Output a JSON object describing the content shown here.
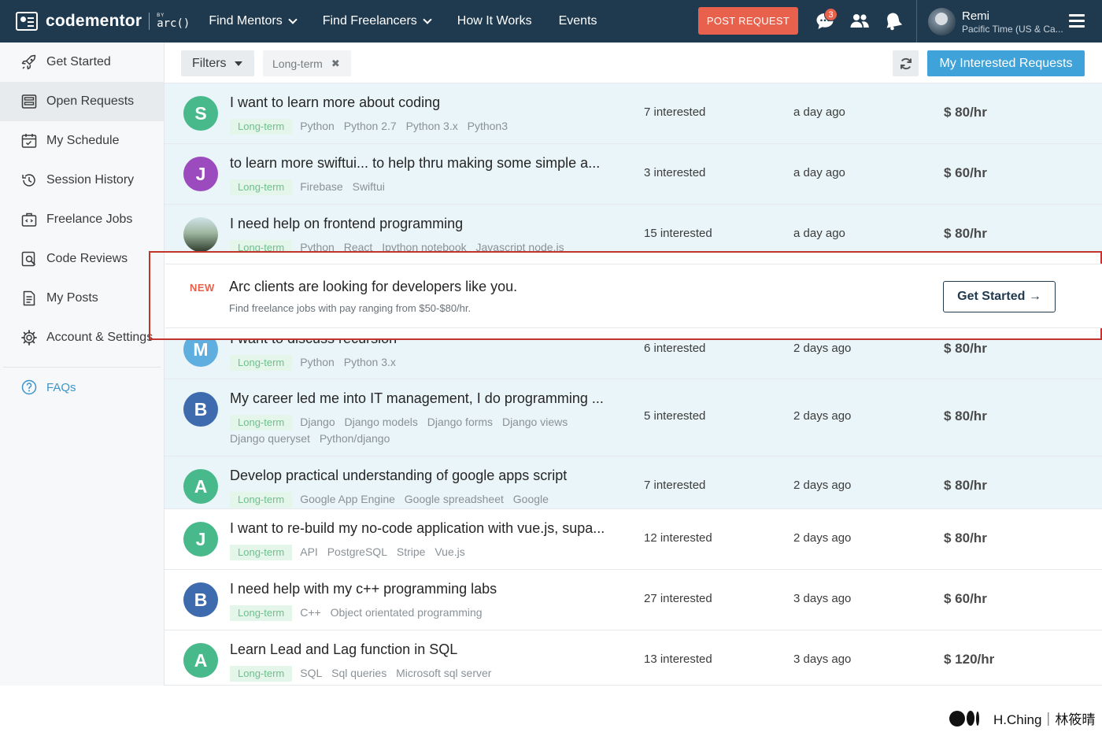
{
  "brand": {
    "name": "codementor",
    "by": "BY",
    "arc": "arc()"
  },
  "nav": {
    "items": [
      {
        "label": "Find Mentors",
        "dropdown": true
      },
      {
        "label": "Find Freelancers",
        "dropdown": true
      },
      {
        "label": "How It Works",
        "dropdown": false
      },
      {
        "label": "Events",
        "dropdown": false
      }
    ],
    "post_request": "POST REQUEST",
    "messages_badge": "3",
    "icons": [
      "chat-icon",
      "people-icon",
      "bell-icon",
      "menu-icon"
    ]
  },
  "user": {
    "name": "Remi",
    "timezone": "Pacific Time (US & Ca..."
  },
  "sidebar": {
    "items": [
      {
        "label": "Get Started",
        "icon": "rocket-icon"
      },
      {
        "label": "Open Requests",
        "icon": "list-icon",
        "active": true
      },
      {
        "label": "My Schedule",
        "icon": "calendar-icon"
      },
      {
        "label": "Session History",
        "icon": "history-icon"
      },
      {
        "label": "Freelance Jobs",
        "icon": "briefcase-icon"
      },
      {
        "label": "Code Reviews",
        "icon": "code-review-icon"
      },
      {
        "label": "My Posts",
        "icon": "document-icon"
      },
      {
        "label": "Account & Settings",
        "icon": "gear-icon"
      }
    ],
    "faq": "FAQs"
  },
  "filterbar": {
    "filters_label": "Filters",
    "active_chip": "Long-term",
    "interested_button": "My Interested Requests"
  },
  "requests": [
    {
      "initial": "S",
      "color": "#48b98a",
      "title": "I want to learn more about coding",
      "tags": [
        "Python",
        "Python 2.7",
        "Python 3.x",
        "Python3"
      ],
      "interested": "7 interested",
      "ago": "a day ago",
      "rate": "$ 80/hr"
    },
    {
      "initial": "J",
      "color": "#9b4bbd",
      "title": "to learn more swiftui... to help thru making some simple a...",
      "tags": [
        "Firebase",
        "Swiftui"
      ],
      "interested": "3 interested",
      "ago": "a day ago",
      "rate": "$ 60/hr"
    },
    {
      "initial": "",
      "color": "#3e5a3e",
      "photo": true,
      "title": "I need help on frontend programming",
      "tags": [
        "Python",
        "React",
        "Ipython notebook",
        "Javascript node.js"
      ],
      "interested": "15 interested",
      "ago": "a day ago",
      "rate": "$ 80/hr"
    },
    {
      "initial": "M",
      "color": "#5faee0",
      "title": "I want to discuss recursion",
      "tags": [
        "Python",
        "Python 3.x"
      ],
      "interested": "6 interested",
      "ago": "2 days ago",
      "rate": "$ 80/hr"
    },
    {
      "initial": "B",
      "color": "#3d6bad",
      "title": "My career led me into IT management, I do programming ...",
      "tags": [
        "Django",
        "Django models",
        "Django forms",
        "Django views",
        "Django queryset",
        "Python/django"
      ],
      "interested": "5 interested",
      "ago": "2 days ago",
      "rate": "$ 80/hr"
    },
    {
      "initial": "A",
      "color": "#48b98a",
      "title": "Develop practical understanding of google apps script",
      "tags": [
        "Google App Engine",
        "Google spreadsheet",
        "Google"
      ],
      "interested": "7 interested",
      "ago": "2 days ago",
      "rate": "$ 80/hr"
    },
    {
      "initial": "J",
      "color": "#48b98a",
      "title": "I want to re-build my no-code application with vue.js, supa...",
      "tags": [
        "API",
        "PostgreSQL",
        "Stripe",
        "Vue.js"
      ],
      "interested": "12 interested",
      "ago": "2 days ago",
      "rate": "$ 80/hr"
    },
    {
      "initial": "B",
      "color": "#3d6bad",
      "title": "I need help with my c++ programming labs",
      "tags": [
        "C++",
        "Object orientated programming"
      ],
      "interested": "27 interested",
      "ago": "3 days ago",
      "rate": "$ 60/hr"
    },
    {
      "initial": "A",
      "color": "#48b98a",
      "title": "Learn Lead and Lag function in SQL",
      "tags": [
        "SQL",
        "Sql queries",
        "Microsoft sql server"
      ],
      "interested": "13 interested",
      "ago": "3 days ago",
      "rate": "$ 120/hr"
    }
  ],
  "long_term_label": "Long-term",
  "promo": {
    "new_label": "NEW",
    "title": "Arc clients are looking for developers like you.",
    "subtitle": "Find freelance jobs with pay ranging from $50-$80/hr.",
    "button": "Get Started →"
  },
  "watermark": {
    "text": "H.Ching｜林筱晴"
  }
}
